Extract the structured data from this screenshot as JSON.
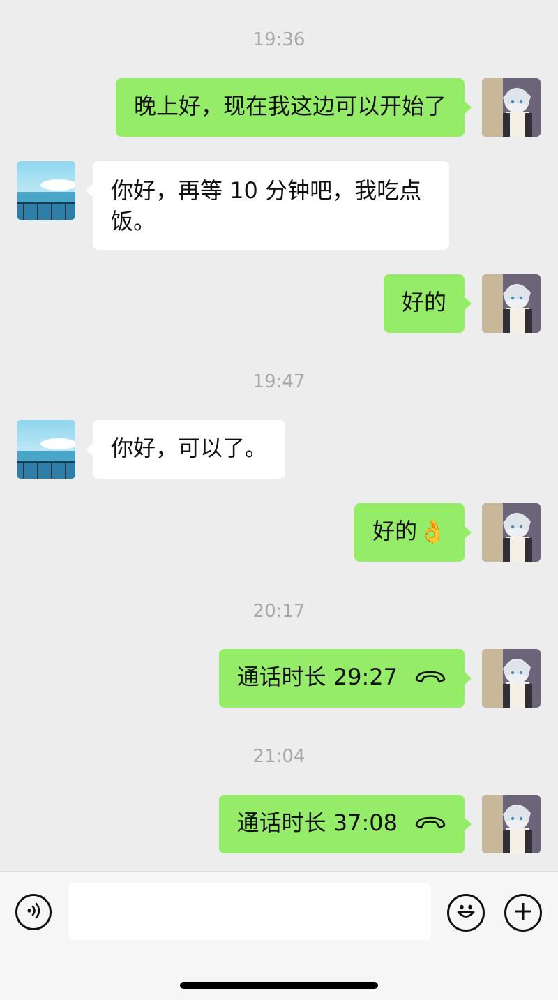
{
  "chat": {
    "times": [
      "19:36",
      "19:47",
      "20:17",
      "21:04"
    ],
    "messages": [
      {
        "sender": "me",
        "text": "晚上好，现在我这边可以开始了"
      },
      {
        "sender": "them",
        "line1": "你好，再等 10 分钟吧，我吃点",
        "line2": "饭。"
      },
      {
        "sender": "me",
        "text": "好的"
      },
      {
        "sender": "them",
        "text": "你好，可以了。"
      },
      {
        "sender": "me",
        "text": "好的",
        "emoji": "👌"
      },
      {
        "sender": "me",
        "type": "call",
        "text": "通话时长 29:27"
      },
      {
        "sender": "me",
        "type": "call",
        "text": "通话时长 37:08"
      }
    ]
  },
  "input_bar": {
    "voice_icon": "voice-icon",
    "emoji_icon": "emoji-icon",
    "plus_icon": "plus-icon",
    "placeholder": ""
  },
  "colors": {
    "background": "#ededed",
    "my_bubble": "#95ec69",
    "their_bubble": "#ffffff",
    "timestamp": "#a8a8a8"
  }
}
